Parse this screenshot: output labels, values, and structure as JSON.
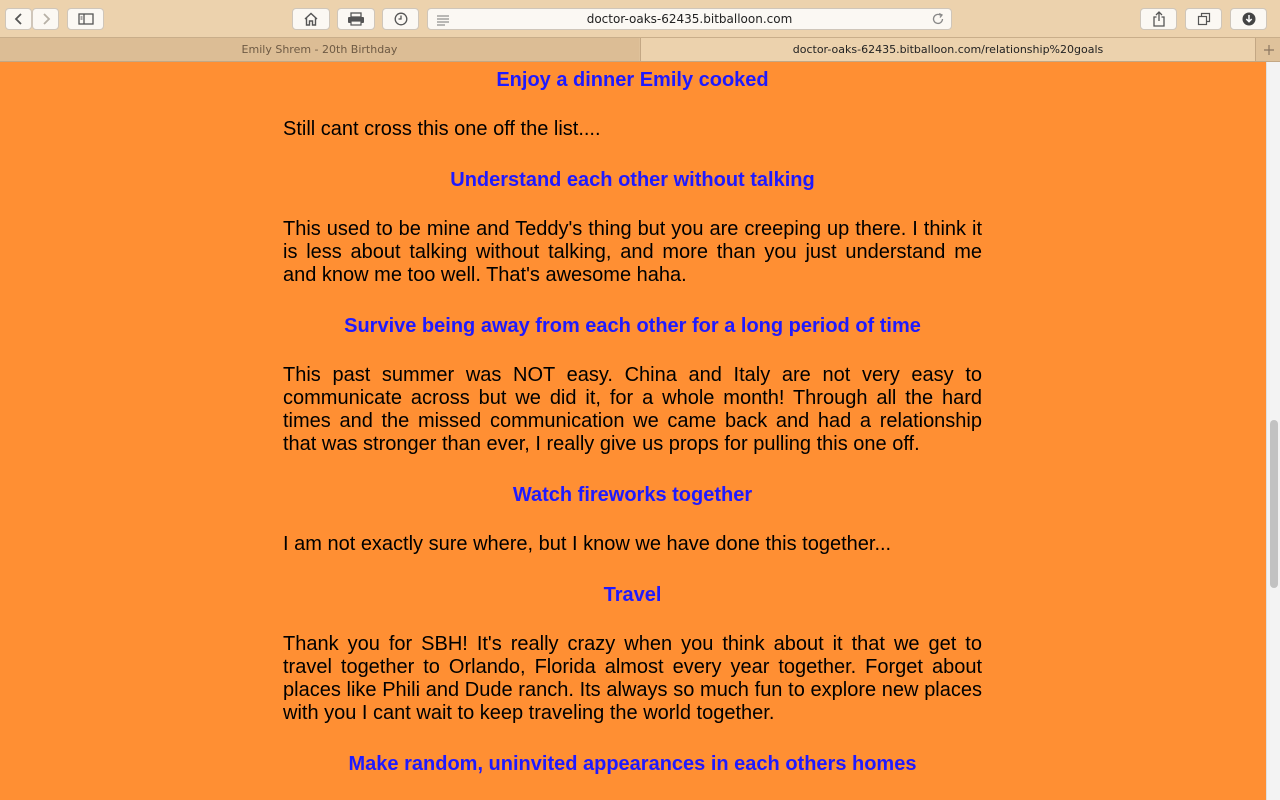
{
  "browser": {
    "url": "doctor-oaks-62435.bitballoon.com",
    "tabs": [
      {
        "label": "Emily Shrem - 20th Birthday",
        "active": false
      },
      {
        "label": "doctor-oaks-62435.bitballoon.com/relationship%20goals",
        "active": true
      }
    ],
    "icons": {
      "back": "chevron-left-icon",
      "forward": "chevron-right-icon",
      "sidebar": "sidebar-icon",
      "home": "home-icon",
      "print": "print-icon",
      "history": "clock-icon",
      "reader": "reader-icon",
      "reload": "reload-icon",
      "share": "share-icon",
      "tabs": "tabs-icon",
      "downloads": "download-icon",
      "new_tab": "plus-icon"
    }
  },
  "page": {
    "background": "#ff8f33",
    "title_color": "#1f1aff",
    "goals": [
      {
        "title": "Enjoy a dinner Emily cooked",
        "text": "Still cant cross this one off the list...."
      },
      {
        "title": "Understand each other without talking",
        "text": "This used to be mine and Teddy's thing but you are creeping up there. I think it is less about talking without talking, and more than you just understand me and know me too well. That's awesome haha."
      },
      {
        "title": "Survive being away from each other for a long period of time",
        "text": "This past summer was NOT easy. China and Italy are not very easy to communicate across but we did it, for a whole month! Through all the hard times and the missed communication we came back and had a relationship that was stronger than ever, I really give us props for pulling this one off."
      },
      {
        "title": "Watch fireworks together",
        "text": "I am not exactly sure where, but I know we have done this together..."
      },
      {
        "title": "Travel",
        "text": "Thank you for SBH! It's really crazy when you think about it that we get to travel together to Orlando, Florida almost every year together. Forget about places like Phili and Dude ranch. Its always so much fun to explore new places with you I cant wait to keep traveling the world together."
      },
      {
        "title": "Make random, uninvited appearances in each others homes",
        "text": ""
      }
    ]
  }
}
